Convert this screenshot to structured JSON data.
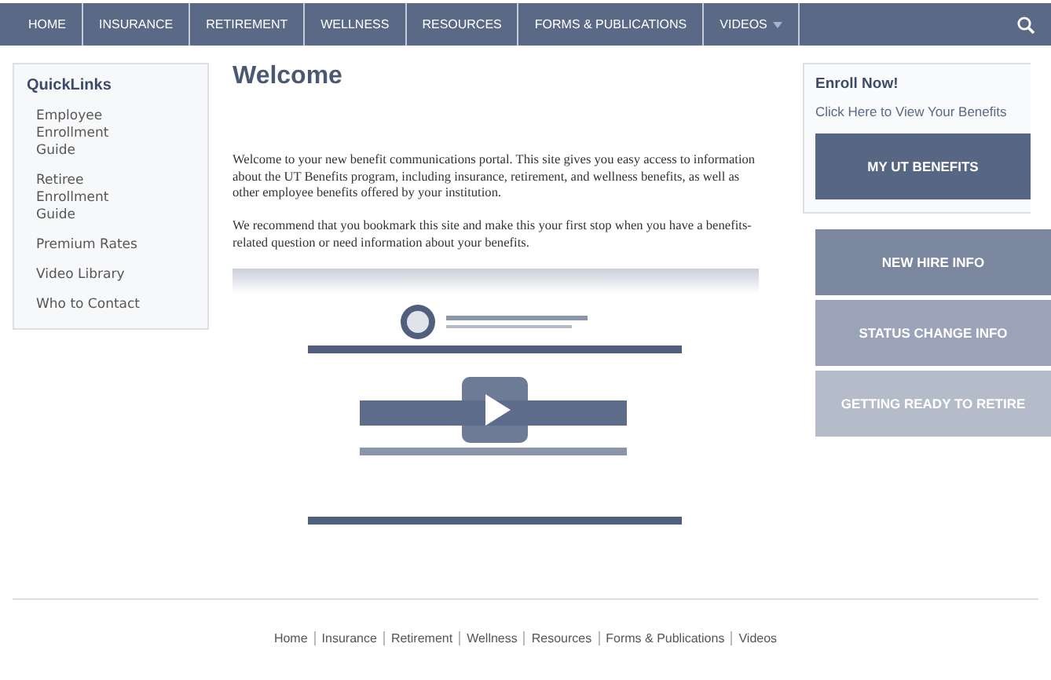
{
  "nav": {
    "items": [
      {
        "label": "HOME",
        "dropdown": false
      },
      {
        "label": "INSURANCE",
        "dropdown": false
      },
      {
        "label": "RETIREMENT",
        "dropdown": false
      },
      {
        "label": "WELLNESS",
        "dropdown": false
      },
      {
        "label": "RESOURCES",
        "dropdown": false
      },
      {
        "label": "FORMS & PUBLICATIONS",
        "dropdown": false
      },
      {
        "label": "VIDEOS",
        "dropdown": true
      }
    ]
  },
  "quicklinks": {
    "title": "QuickLinks",
    "items": [
      "Employee Enrollment Guide",
      "Retiree Enrollment Guide",
      "Premium Rates",
      "Video Library",
      "Who to Contact"
    ]
  },
  "main": {
    "title": "Welcome",
    "paragraphs": [
      "Welcome to your new benefit communications portal. This site gives you easy access to information about the UT Benefits program, including insurance, retirement, and wellness benefits, as well as other employee benefits offered by your institution.",
      "We recommend that you bookmark this site and make this your first stop when you have a benefits-related question or need information about your benefits."
    ],
    "video": {
      "kind": "picture"
    }
  },
  "enroll": {
    "title": "Enroll Now!",
    "link": "Click Here to View Your Benefits",
    "button": "MY UT BENEFITS"
  },
  "side_buttons": [
    {
      "label": "NEW HIRE INFO",
      "color": "#7a879f"
    },
    {
      "label": "STATUS CHANGE INFO",
      "color": "#9aa3b7"
    },
    {
      "label": "GETTING READY TO RETIRE",
      "color": "#b4bbc9"
    }
  ],
  "footer": {
    "links": [
      "Home",
      "Insurance",
      "Retirement",
      "Wellness",
      "Resources",
      "Forms & Publications",
      "Videos"
    ]
  }
}
